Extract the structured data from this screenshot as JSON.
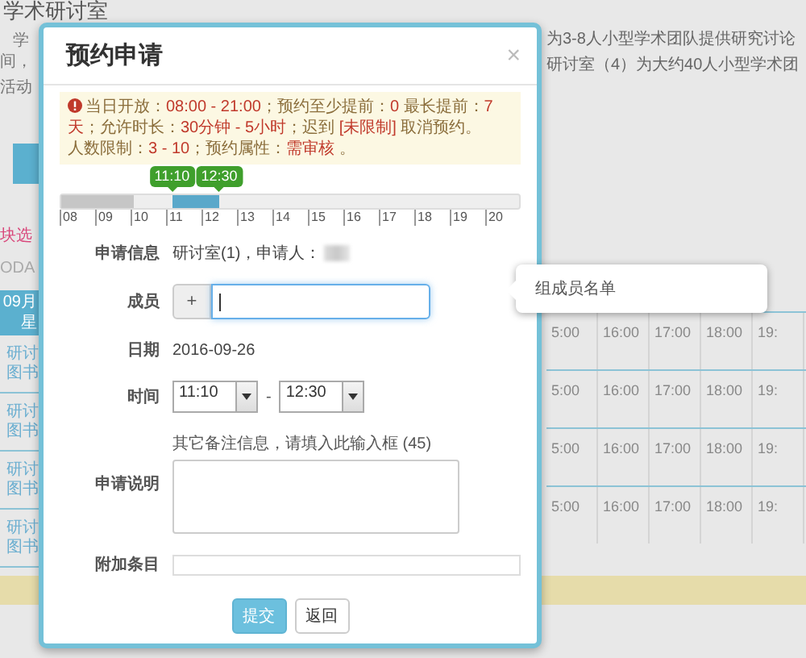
{
  "background": {
    "heading": "学术研讨室",
    "intro_left": [
      "学",
      "间，",
      "活动"
    ],
    "intro_right": [
      "为3-8人小型学术团队提供研究讨论",
      "研讨室（4）为大约40人小型学术团"
    ],
    "notice": "块选",
    "date_label": "ODA",
    "table_header": [
      "09月",
      "星"
    ],
    "rows": [
      {
        "room": [
          "研讨",
          "图书"
        ],
        "times": [
          "5:00",
          "16:00",
          "17:00",
          "18:00",
          "19:"
        ]
      },
      {
        "room": [
          "研讨",
          "图书"
        ],
        "times": [
          "5:00",
          "16:00",
          "17:00",
          "18:00",
          "19:"
        ]
      },
      {
        "room": [
          "研讨",
          "图书"
        ],
        "times": [
          "5:00",
          "16:00",
          "17:00",
          "18:00",
          "19:"
        ]
      },
      {
        "room": [
          "研讨",
          "图书"
        ],
        "times": [
          "5:00",
          "16:00",
          "17:00",
          "18:00",
          "19:"
        ]
      }
    ]
  },
  "modal": {
    "title": "预约申请",
    "close": "×",
    "alert": {
      "paragraphs": [
        [
          {
            "text": "当日开放：",
            "kind": "label"
          },
          {
            "text": "08:00 - 21:00",
            "kind": "value"
          },
          {
            "text": "；预约至少提前：",
            "kind": "label"
          },
          {
            "text": "0",
            "kind": "value"
          },
          {
            "text": " 最长提前：",
            "kind": "label"
          },
          {
            "text": "7天",
            "kind": "value"
          },
          {
            "text": "；允许时长：",
            "kind": "label"
          },
          {
            "text": "30分钟 - 5小时",
            "kind": "value"
          },
          {
            "text": "；迟到 ",
            "kind": "label"
          },
          {
            "text": "[未限制]",
            "kind": "value"
          },
          {
            "text": " 取消预约。",
            "kind": "label"
          }
        ],
        [
          {
            "text": "人数限制：",
            "kind": "label"
          },
          {
            "text": "3 - 10",
            "kind": "value"
          },
          {
            "text": "；预约属性：",
            "kind": "label"
          },
          {
            "text": "需审核",
            "kind": "value"
          },
          {
            "text": " 。",
            "kind": "label"
          }
        ]
      ]
    },
    "timeline": {
      "level": 0.16,
      "start": "11:10",
      "end": "12:30",
      "ticks": [
        "08",
        "09",
        "10",
        "11",
        "12",
        "13",
        "14",
        "15",
        "16",
        "17",
        "18",
        "19",
        "20"
      ]
    },
    "form": {
      "applicant_info": {
        "label": "申请信息",
        "value": "研讨室(1)，申请人："
      },
      "members": {
        "label": "成员",
        "add": "+",
        "focused": true
      },
      "date": {
        "label": "日期",
        "value": "2016-09-26"
      },
      "time": {
        "label": "时间",
        "start": "11:10",
        "separator": "-",
        "end": "12:30"
      },
      "description": {
        "label": "申请说明",
        "hint": "其它备注信息，请填入此输入框 (45)"
      },
      "extra": {
        "label": "附加条目"
      }
    },
    "buttons": [
      {
        "label": "提交",
        "kind": "primary"
      },
      {
        "label": "返回",
        "kind": "default"
      }
    ]
  },
  "tooltip": {
    "text": "组成员名单"
  }
}
